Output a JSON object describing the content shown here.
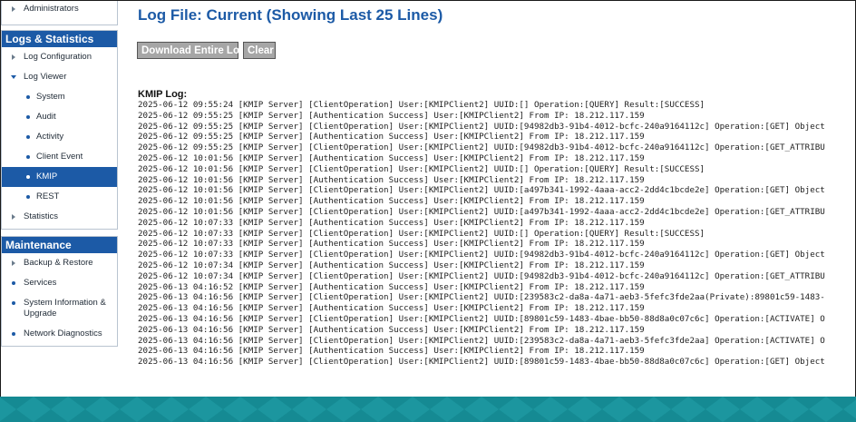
{
  "sidebar": {
    "top_item": "Administrators",
    "logs_title": "Logs & Statistics",
    "logs_items": {
      "log_configuration": "Log Configuration",
      "log_viewer": "Log Viewer",
      "system": "System",
      "audit": "Audit",
      "activity": "Activity",
      "client_event": "Client Event",
      "kmip": "KMIP",
      "rest": "REST",
      "statistics": "Statistics"
    },
    "maintenance_title": "Maintenance",
    "maintenance_items": {
      "backup_restore": "Backup & Restore",
      "services": "Services",
      "system_info_line1": "System Information &",
      "system_info_line2": "Upgrade",
      "network_diagnostics": "Network Diagnostics"
    }
  },
  "main": {
    "title": "Log File: Current (Showing Last 25 Lines)",
    "download_button": "Download Entire Log",
    "clear_button": "Clear",
    "log_label": "KMIP Log:",
    "lines": [
      "2025-06-12 09:55:24 [KMIP Server] [ClientOperation] User:[KMIPClient2] UUID:[] Operation:[QUERY] Result:[SUCCESS]",
      "2025-06-12 09:55:25 [KMIP Server] [Authentication Success] User:[KMIPClient2] From IP: 18.212.117.159",
      "2025-06-12 09:55:25 [KMIP Server] [ClientOperation] User:[KMIPClient2] UUID:[94982db3-91b4-4012-bcfc-240a9164112c] Operation:[GET] Object",
      "2025-06-12 09:55:25 [KMIP Server] [Authentication Success] User:[KMIPClient2] From IP: 18.212.117.159",
      "2025-06-12 09:55:25 [KMIP Server] [ClientOperation] User:[KMIPClient2] UUID:[94982db3-91b4-4012-bcfc-240a9164112c] Operation:[GET_ATTRIBU",
      "2025-06-12 10:01:56 [KMIP Server] [Authentication Success] User:[KMIPClient2] From IP: 18.212.117.159",
      "2025-06-12 10:01:56 [KMIP Server] [ClientOperation] User:[KMIPClient2] UUID:[] Operation:[QUERY] Result:[SUCCESS]",
      "2025-06-12 10:01:56 [KMIP Server] [Authentication Success] User:[KMIPClient2] From IP: 18.212.117.159",
      "2025-06-12 10:01:56 [KMIP Server] [ClientOperation] User:[KMIPClient2] UUID:[a497b341-1992-4aaa-acc2-2dd4c1bcde2e] Operation:[GET] Object",
      "2025-06-12 10:01:56 [KMIP Server] [Authentication Success] User:[KMIPClient2] From IP: 18.212.117.159",
      "2025-06-12 10:01:56 [KMIP Server] [ClientOperation] User:[KMIPClient2] UUID:[a497b341-1992-4aaa-acc2-2dd4c1bcde2e] Operation:[GET_ATTRIBU",
      "2025-06-12 10:07:33 [KMIP Server] [Authentication Success] User:[KMIPClient2] From IP: 18.212.117.159",
      "2025-06-12 10:07:33 [KMIP Server] [ClientOperation] User:[KMIPClient2] UUID:[] Operation:[QUERY] Result:[SUCCESS]",
      "2025-06-12 10:07:33 [KMIP Server] [Authentication Success] User:[KMIPClient2] From IP: 18.212.117.159",
      "2025-06-12 10:07:33 [KMIP Server] [ClientOperation] User:[KMIPClient2] UUID:[94982db3-91b4-4012-bcfc-240a9164112c] Operation:[GET] Object",
      "2025-06-12 10:07:34 [KMIP Server] [Authentication Success] User:[KMIPClient2] From IP: 18.212.117.159",
      "2025-06-12 10:07:34 [KMIP Server] [ClientOperation] User:[KMIPClient2] UUID:[94982db3-91b4-4012-bcfc-240a9164112c] Operation:[GET_ATTRIBU",
      "2025-06-13 04:16:52 [KMIP Server] [Authentication Success] User:[KMIPClient2] From IP: 18.212.117.159",
      "2025-06-13 04:16:56 [KMIP Server] [ClientOperation] User:[KMIPClient2] UUID:[239583c2-da8a-4a71-aeb3-5fefc3fde2aa(Private):89801c59-1483-",
      "2025-06-13 04:16:56 [KMIP Server] [Authentication Success] User:[KMIPClient2] From IP: 18.212.117.159",
      "2025-06-13 04:16:56 [KMIP Server] [ClientOperation] User:[KMIPClient2] UUID:[89801c59-1483-4bae-bb50-88d8a0c07c6c] Operation:[ACTIVATE] O",
      "2025-06-13 04:16:56 [KMIP Server] [Authentication Success] User:[KMIPClient2] From IP: 18.212.117.159",
      "2025-06-13 04:16:56 [KMIP Server] [ClientOperation] User:[KMIPClient2] UUID:[239583c2-da8a-4a71-aeb3-5fefc3fde2aa] Operation:[ACTIVATE] O",
      "2025-06-13 04:16:56 [KMIP Server] [Authentication Success] User:[KMIPClient2] From IP: 18.212.117.159",
      "2025-06-13 04:16:56 [KMIP Server] [ClientOperation] User:[KMIPClient2] UUID:[89801c59-1483-4bae-bb50-88d8a0c07c6c] Operation:[GET] Object"
    ]
  },
  "colors": {
    "accent": "#1c5aa6",
    "footer": "#158a93",
    "button": "#a6a6a6"
  },
  "icons": {
    "collapsed": "chevron-right-icon",
    "expanded": "chevron-down-icon",
    "bullet": "bullet-dot-icon"
  }
}
